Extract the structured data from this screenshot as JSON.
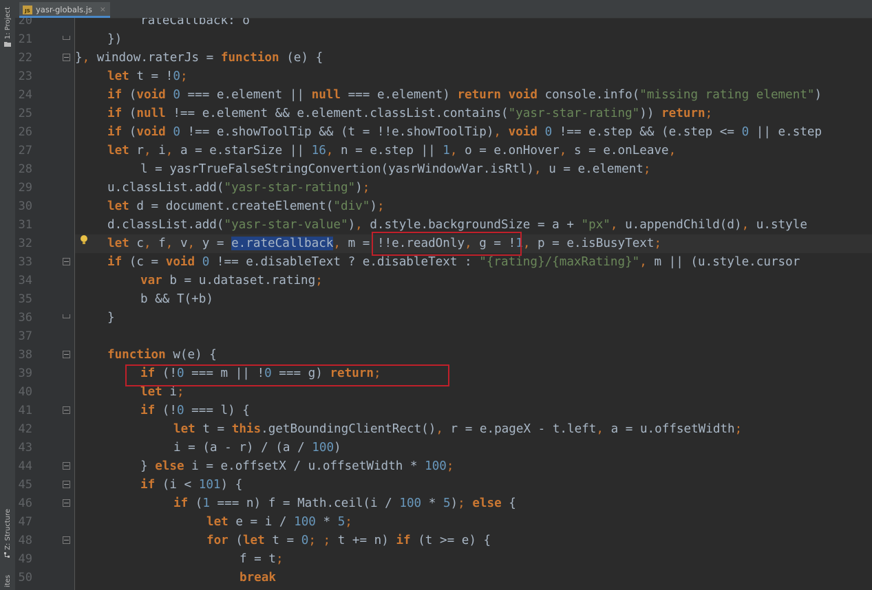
{
  "toolwindows": {
    "project": "1: Project",
    "structure": "Z: Structure",
    "favorites": "ites"
  },
  "tab": {
    "filename": "yasr-globals.js",
    "file_icon_text": "JS",
    "close_glyph": "×"
  },
  "editor": {
    "line_numbers": [
      "20",
      "21",
      "22",
      "23",
      "24",
      "25",
      "26",
      "27",
      "28",
      "29",
      "30",
      "31",
      "32",
      "33",
      "34",
      "35",
      "36",
      "37",
      "38",
      "39",
      "40",
      "41",
      "42",
      "43",
      "44",
      "45",
      "46",
      "47",
      "48",
      "49",
      "50"
    ],
    "current_line": "32",
    "highlighted_lines": [
      "32",
      "39"
    ]
  },
  "colors": {
    "background": "#2b2b2b",
    "keyword": "#cc7832",
    "number": "#6897bb",
    "string": "#6a8759",
    "annotation_box": "#c0202a",
    "selection": "#214283"
  },
  "icons": [
    "js-file-icon",
    "close-icon",
    "folder-icon",
    "structure-icon",
    "lightbulb-icon",
    "fold-icon"
  ]
}
